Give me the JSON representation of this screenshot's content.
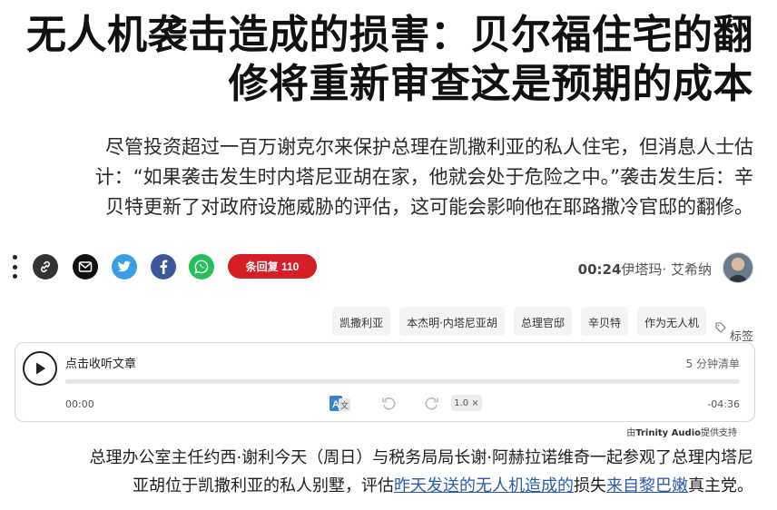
{
  "article": {
    "headline_line1": "无人机袭击造成的损害：贝尔福住宅的翻",
    "headline_line2": "修将重新审查这是预期的成本",
    "lede_line1": "尽管投资超过一百万谢克尔来保护总理在凯撒利亚的私人住宅，但消息人士估",
    "lede_line2": "计：“如果袭击发生时内塔尼亚胡在家，他就会处于危险之中。”袭击发生后：辛",
    "lede_line3": "。贝特更新了对政府设施威胁的评估，这可能会影响他在耶路撒冷官邸的翻修"
  },
  "share": {
    "icons": [
      "more-dots-icon",
      "link-icon",
      "email-icon",
      "twitter-icon",
      "facebook-icon",
      "whatsapp-icon"
    ],
    "comments_label": "条回复",
    "comments_count": "110",
    "comments_color": "#d41f26"
  },
  "byline": {
    "time": "00:24",
    "location": "伊塔玛·",
    "author": "艾希纳"
  },
  "tags": {
    "label": "标签",
    "items": [
      "作为无人机",
      "辛贝特",
      "总理官邸",
      "本杰明·内塔尼亚胡",
      "凯撒利亚"
    ]
  },
  "player": {
    "title": "点击收听文章",
    "read_time": "5 分钟清单",
    "time_start": "00:00",
    "time_end": "-04:36",
    "speed": "1.0 ×",
    "progress": 0
  },
  "powered": {
    "prefix": "由",
    "brand": "Trinity Audio",
    "suffix": "提供支持"
  },
  "body": {
    "p1_line1": "总理办公室主任约西·谢利今天（周日）与税务局局长谢·阿赫拉诺维奇一起参观了总理内塔尼",
    "p1_line2_a": "。亚胡位于凯撒利亚的私人别墅，评估",
    "p1_line2_link1": "昨天发送的无人机造成的",
    "p1_line2_b": "损失",
    "p1_line2_link2": "来自黎巴嫩",
    "p1_line2_c": "真主党"
  }
}
